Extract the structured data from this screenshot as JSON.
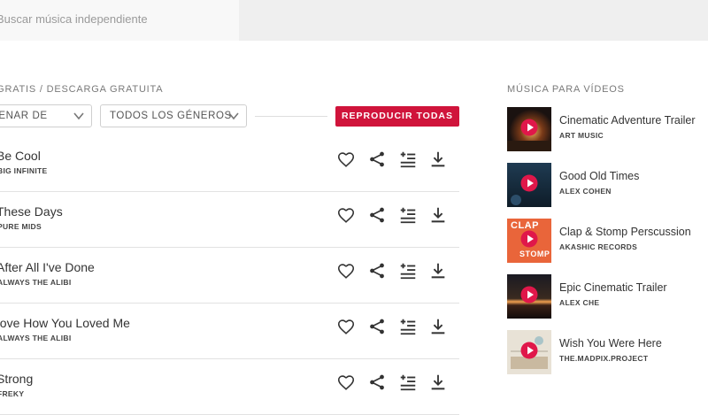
{
  "search": {
    "placeholder": "Buscar música independiente"
  },
  "free_section": {
    "heading": "HITS GRATIS / DESCARGA GRATUITA",
    "sort_dropdown": "ORDENAR DE",
    "genre_dropdown": "TODOS LOS GÉNEROS",
    "play_all_label": "REPRODUCIR TODAS",
    "accent_color": "#d0143b"
  },
  "tracks": [
    {
      "title": "Be Cool",
      "artist": "BIG INFINITE"
    },
    {
      "title": "These Days",
      "artist": "PURE MIDS"
    },
    {
      "title": "After All I've Done",
      "artist": "ALWAYS THE ALIBI"
    },
    {
      "title": "Love How You Loved Me",
      "artist": "ALWAYS THE ALIBI"
    },
    {
      "title": "Strong",
      "artist": "FREKY"
    }
  ],
  "track_actions": [
    "heart-icon",
    "share-icon",
    "add-to-playlist-icon",
    "download-icon"
  ],
  "video_section": {
    "heading": "MÚSICA PARA VÍDEOS",
    "items": [
      {
        "title": "Cinematic Adventure Trailer",
        "artist": "ART MUSIC"
      },
      {
        "title": "Good Old Times",
        "artist": "ALEX COHEN"
      },
      {
        "title": "Clap & Stomp Perscussion",
        "artist": "AKASHIC RECORDS",
        "thumb_text_top": "CLAP",
        "thumb_text_bottom": "STOMP"
      },
      {
        "title": "Epic Cinematic Trailer",
        "artist": "ALEX CHE"
      },
      {
        "title": "Wish You Were Here",
        "artist": "THE.MADPIX.PROJECT"
      }
    ]
  }
}
